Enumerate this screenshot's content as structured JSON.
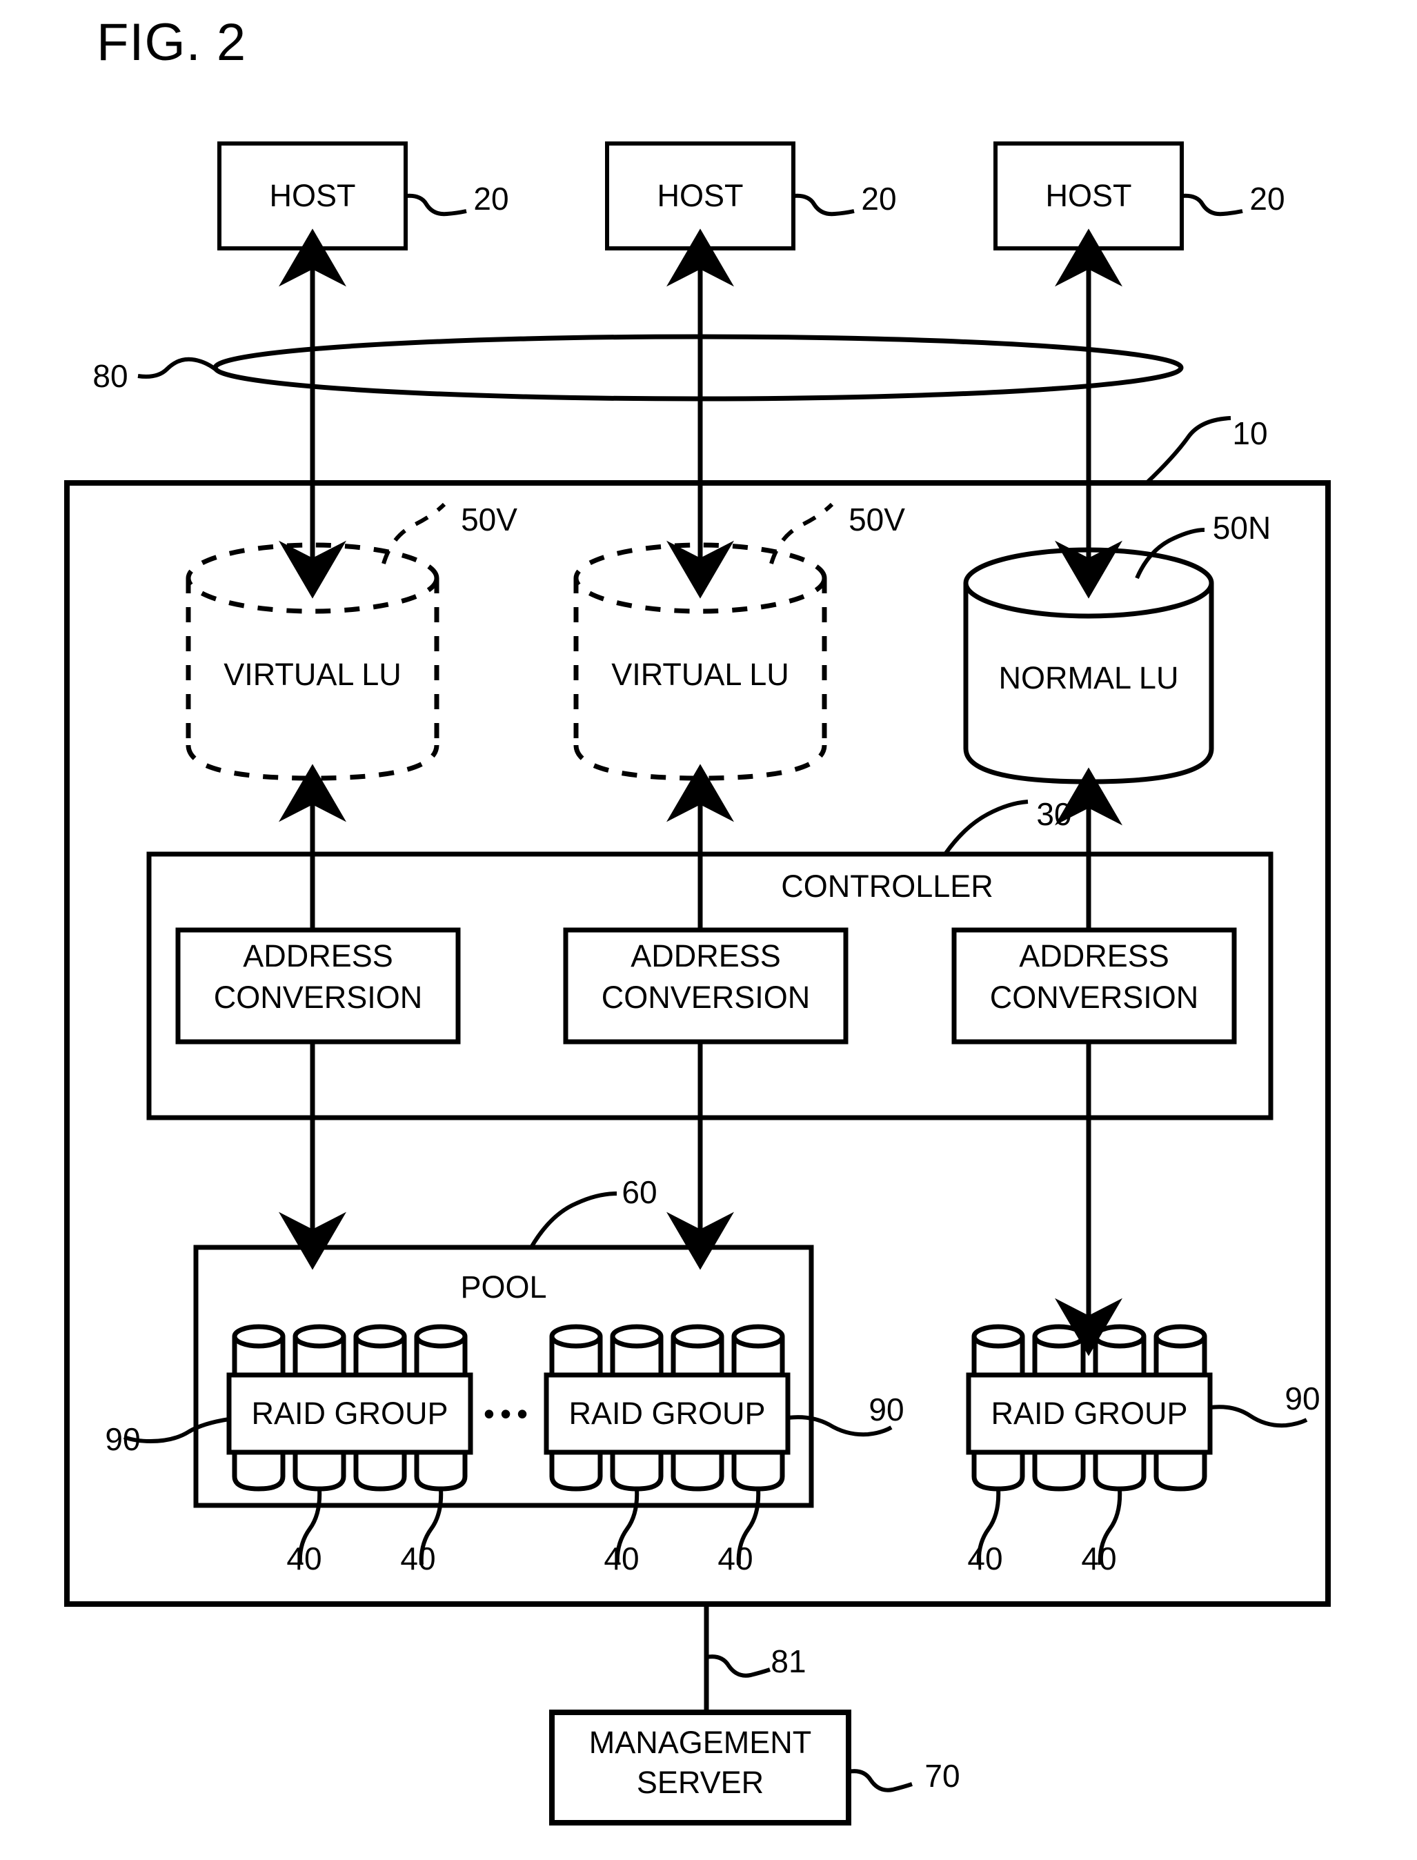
{
  "figure": {
    "title": "FIG. 2",
    "domain_note": "patent block diagram of a storage system"
  },
  "hosts": [
    {
      "label": "HOST",
      "ref": "20"
    },
    {
      "label": "HOST",
      "ref": "20"
    },
    {
      "label": "HOST",
      "ref": "20"
    }
  ],
  "network": {
    "ref": "80"
  },
  "storage_system": {
    "ref": "10"
  },
  "logical_units": [
    {
      "label": "VIRTUAL LU",
      "ref": "50V",
      "style": "dashed"
    },
    {
      "label": "VIRTUAL LU",
      "ref": "50V",
      "style": "dashed"
    },
    {
      "label": "NORMAL LU",
      "ref": "50N",
      "style": "solid"
    }
  ],
  "controller": {
    "label": "CONTROLLER",
    "ref": "30",
    "modules": [
      {
        "line1": "ADDRESS",
        "line2": "CONVERSION"
      },
      {
        "line1": "ADDRESS",
        "line2": "CONVERSION"
      },
      {
        "line1": "ADDRESS",
        "line2": "CONVERSION"
      }
    ]
  },
  "pool": {
    "label": "POOL",
    "ref": "60",
    "ellipsis": "•••",
    "raid_groups": [
      {
        "label": "RAID GROUP",
        "ref": "90",
        "disk_refs": [
          "40",
          "40"
        ]
      },
      {
        "label": "RAID GROUP",
        "ref": "90",
        "disk_refs": [
          "40",
          "40"
        ]
      }
    ]
  },
  "external_raid_group": {
    "label": "RAID GROUP",
    "ref": "90",
    "disk_refs": [
      "40",
      "40"
    ]
  },
  "management": {
    "line1": "MANAGEMENT",
    "line2": "SERVER",
    "ref": "70",
    "link_ref": "81"
  },
  "colors": {
    "stroke": "#000000",
    "background": "#ffffff"
  }
}
